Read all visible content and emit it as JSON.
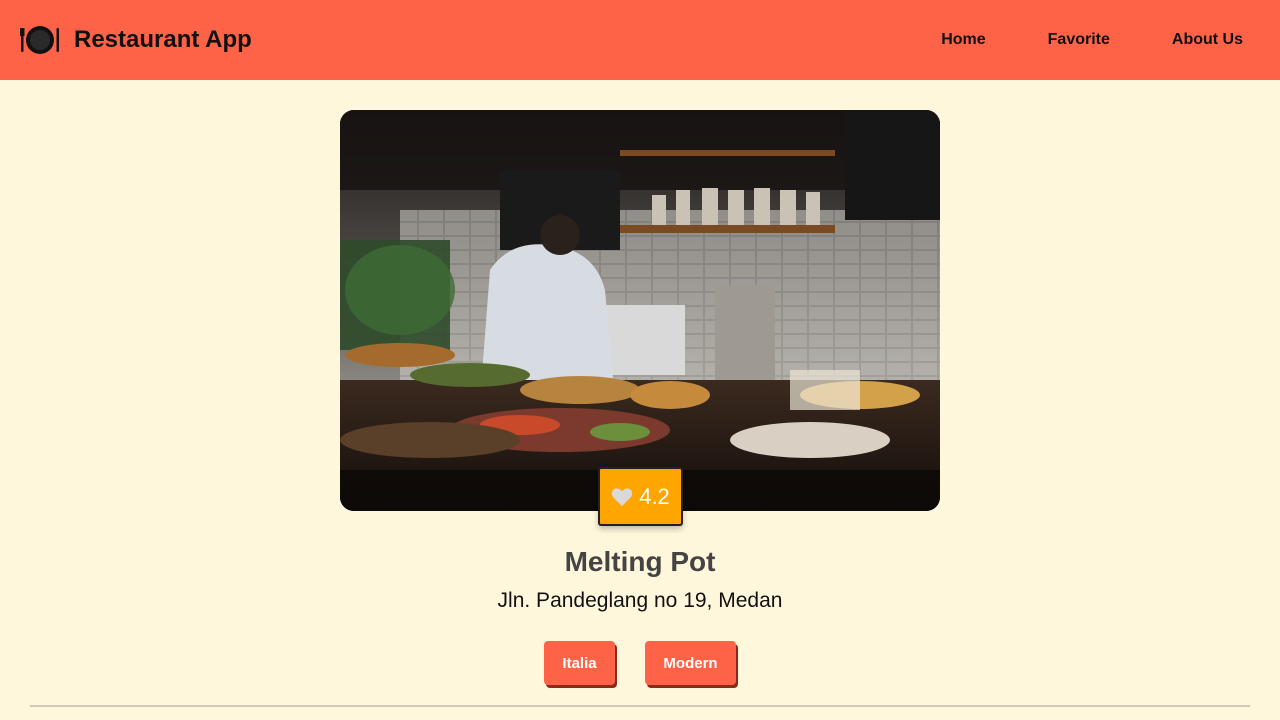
{
  "header": {
    "app_title": "Restaurant App",
    "logo_icon": "plate-cutlery-icon",
    "nav": {
      "home": "Home",
      "favorite": "Favorite",
      "about": "About Us"
    },
    "color": "#ff6347"
  },
  "restaurant": {
    "name": "Melting Pot",
    "address": "Jln. Pandeglang no 19, Medan",
    "rating": "4.2",
    "rating_icon": "heart-icon",
    "categories": [
      "Italia",
      "Modern"
    ]
  },
  "colors": {
    "background": "#fff7dc",
    "accent": "#ff6347",
    "rating_badge": "#ffa500"
  }
}
